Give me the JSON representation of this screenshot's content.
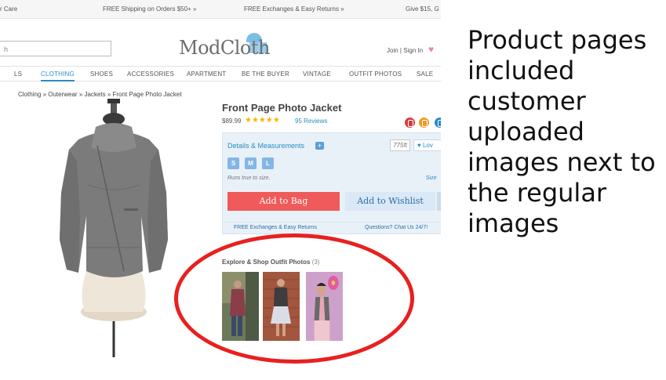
{
  "promo_bar": {
    "care": "r Care",
    "shipping": "FREE Shipping on Orders $50+ »",
    "exchanges": "FREE Exchanges & Easy Returns »",
    "give": "Give $15, G"
  },
  "header": {
    "search_value": "h",
    "logo_text": "ModCloth",
    "auth_text": "Join | Sign In"
  },
  "nav": {
    "items": [
      "LS",
      "CLOTHING",
      "SHOES",
      "ACCESSORIES",
      "APARTMENT",
      "BE THE BUYER",
      "VINTAGE",
      "OUTFIT PHOTOS",
      "SALE"
    ],
    "active_index": 1
  },
  "breadcrumb": "Clothing  »  Outerwear  »  Jackets  »  Front Page Photo Jacket",
  "product": {
    "title": "Front Page Photo Jacket",
    "price": "$89.99",
    "stars": "★★★★★",
    "rating": 4,
    "reviews": "95 Reviews"
  },
  "purchase_panel": {
    "details_label": "Details & Measurements",
    "qty_placeholder": "775ft",
    "love_label": "♥ Lov",
    "sizes": [
      "S",
      "M",
      "L"
    ],
    "fit_note": "Runs true to size.",
    "size_chart_label": "Size",
    "add_to_bag": "Add to Bag",
    "add_to_wishlist": "Add to Wishlist",
    "exchanges_note": "FREE Exchanges & Easy Returns",
    "questions_note": "Questions? Chat Us 24/7!"
  },
  "outfit_photos": {
    "title": "Explore & Shop Outfit Photos",
    "count": "(3)"
  },
  "colors": {
    "accent_blue": "#2a8cc5",
    "bag_button": "#f05a5a",
    "highlight_ellipse": "#e8201f"
  },
  "caption": "Product pages included customer uploaded images next to the regular images"
}
